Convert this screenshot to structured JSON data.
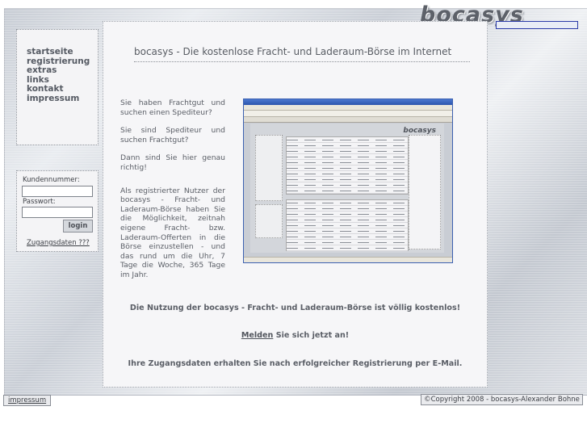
{
  "logo": "bocasys",
  "nav": {
    "items": [
      "startseite",
      "registrierung",
      "extras",
      "links",
      "kontakt",
      "impressum"
    ]
  },
  "login": {
    "customer_label": "Kundennummer:",
    "password_label": "Passwort:",
    "button": "login",
    "access_link": "Zugangsdaten ???"
  },
  "main": {
    "title": "bocasys - Die kostenlose Fracht- und Laderaum-Börse im Internet",
    "paragraphs": [
      "Sie haben Frachtgut und suchen einen Spediteur?",
      "Sie sind Spediteur und suchen Frachtgut?",
      "Dann sind Sie hier genau richtig!",
      "Als registrierter Nutzer der bocasys - Fracht- und Laderaum-Börse haben Sie die Möglichkeit, zeitnah eigene Fracht- bzw. Laderaum-Offerten in die Börse einzustellen - und das rund um die Uhr, 7 Tage die Woche, 365 Tage im Jahr."
    ],
    "screenshot_logo": "bocasys",
    "free_notice": "Die Nutzung der bocasys - Fracht- und Laderaum-Börse ist völlig kostenlos!",
    "signup_link": "Melden",
    "signup_rest": " Sie sich jetzt an!",
    "email_notice": "Ihre Zugangsdaten erhalten Sie nach erfolgreicher Registrierung per E-Mail."
  },
  "footer": {
    "impressum": "impressum",
    "copyright": "©Copyright 2008 - bocasys-Alexander Bohne"
  }
}
